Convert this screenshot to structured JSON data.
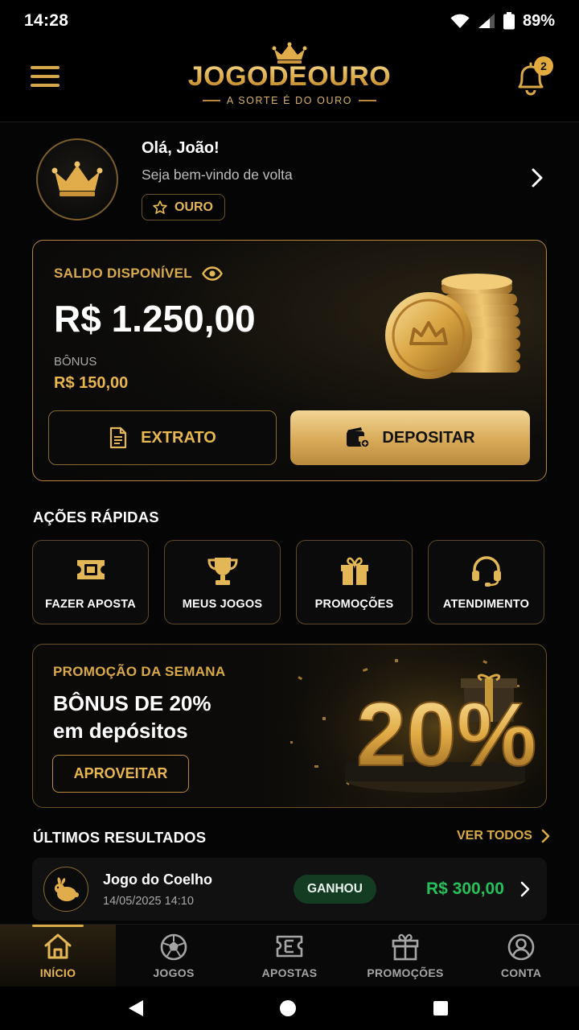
{
  "status_bar": {
    "time": "14:28",
    "battery": "89%"
  },
  "header": {
    "logo_text": "JOGODEOURO",
    "tagline": "A SORTE É DO OURO",
    "notifications_count": "2"
  },
  "profile": {
    "greeting": "Olá, João!",
    "subtitle": "Seja bem-vindo de volta",
    "tier": "OURO"
  },
  "balance": {
    "label": "SALDO DISPONÍVEL",
    "amount": "R$ 1.250,00",
    "bonus_label": "BÔNUS",
    "bonus_amount": "R$ 150,00",
    "statement_button": "EXTRATO",
    "deposit_button": "DEPOSITAR"
  },
  "quick_actions": {
    "title": "AÇÕES RÁPIDAS",
    "items": [
      {
        "label": "FAZER APOSTA",
        "icon": "ticket-icon"
      },
      {
        "label": "MEUS JOGOS",
        "icon": "trophy-icon"
      },
      {
        "label": "PROMOÇÕES",
        "icon": "gift-icon"
      },
      {
        "label": "ATENDIMENTO",
        "icon": "headset-icon"
      }
    ]
  },
  "promo": {
    "kicker": "PROMOÇÃO DA SEMANA",
    "headline_1": "BÔNUS DE 20%",
    "headline_2": "em depósitos",
    "cta": "APROVEITAR",
    "art_text": "20%"
  },
  "results": {
    "title": "ÚLTIMOS RESULTADOS",
    "see_all": "VER TODOS",
    "items": [
      {
        "game": "Jogo do Coelho",
        "datetime": "14/05/2025 14:10",
        "status": "GANHOU",
        "amount": "R$ 300,00"
      }
    ]
  },
  "bottom_nav": {
    "items": [
      {
        "label": "INÍCIO",
        "icon": "home-icon",
        "active": true
      },
      {
        "label": "JOGOS",
        "icon": "soccer-ball-icon"
      },
      {
        "label": "APOSTAS",
        "icon": "bet-slip-icon"
      },
      {
        "label": "PROMOÇÕES",
        "icon": "gift-icon"
      },
      {
        "label": "CONTA",
        "icon": "user-icon"
      }
    ]
  },
  "colors": {
    "gold": "#e3b755",
    "background": "#050505",
    "success": "#25c05a",
    "success_bg": "#143c23"
  }
}
